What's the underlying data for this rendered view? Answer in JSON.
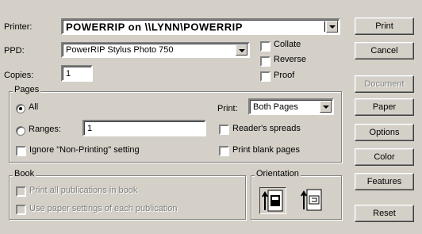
{
  "printer": {
    "label": "Printer:",
    "value": "POWERRIP on \\\\LYNN\\POWERRIP"
  },
  "ppd": {
    "label": "PPD:",
    "value": "PowerRIP Stylus Photo 750"
  },
  "copies": {
    "label": "Copies:",
    "value": "1"
  },
  "options": {
    "collate": "Collate",
    "reverse": "Reverse",
    "proof": "Proof"
  },
  "pages": {
    "title": "Pages",
    "all": "All",
    "ranges": "Ranges:",
    "ranges_value": "1",
    "ignore": "Ignore \"Non-Printing\" setting",
    "print_label": "Print:",
    "print_value": "Both Pages",
    "readers_spreads": "Reader's spreads",
    "print_blank": "Print blank pages"
  },
  "book": {
    "title": "Book",
    "print_all": "Print all publications in book",
    "use_paper": "Use paper settings of each publication"
  },
  "orientation": {
    "title": "Orientation",
    "portrait_icon": "portrait-orientation-icon",
    "landscape_icon": "landscape-orientation-icon"
  },
  "buttons": {
    "print": "Print",
    "cancel": "Cancel",
    "document": "Document",
    "paper": "Paper",
    "options": "Options",
    "color": "Color",
    "features": "Features",
    "reset": "Reset"
  }
}
